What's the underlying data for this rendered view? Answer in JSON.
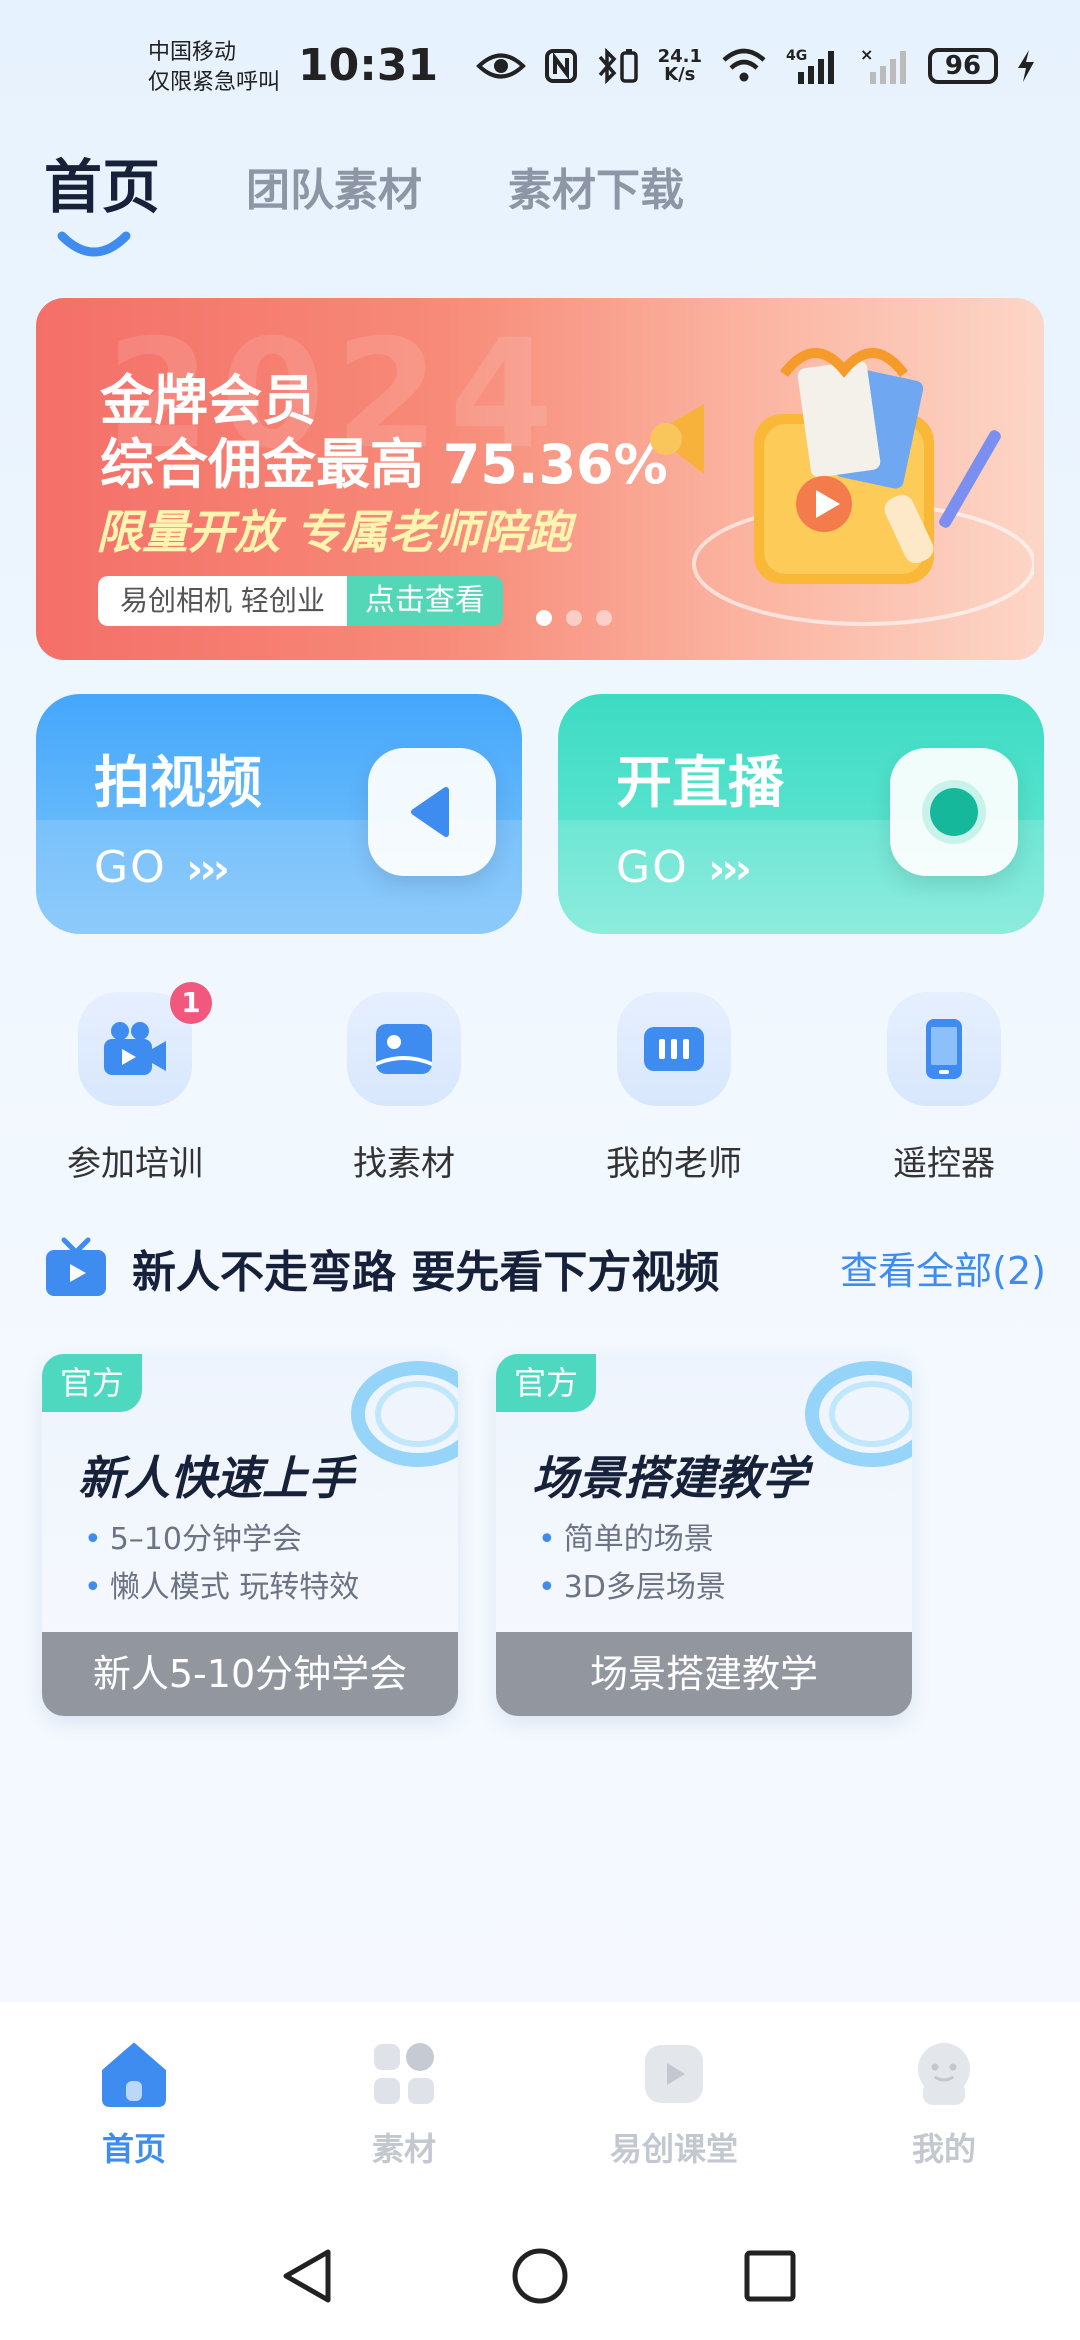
{
  "status_bar": {
    "carrier_line1": "中国移动",
    "carrier_line2": "仅限紧急呼叫",
    "time": "10:31",
    "net_speed_top": "24.1",
    "net_speed_bottom": "K/s",
    "network_type": "4G",
    "battery": "96"
  },
  "top_tabs": [
    {
      "label": "首页",
      "active": true
    },
    {
      "label": "团队素材",
      "active": false
    },
    {
      "label": "素材下载",
      "active": false
    }
  ],
  "banner": {
    "line1": "金牌会员",
    "line2": "综合佣金最高 75.36%",
    "line3": "限量开放 专属老师陪跑",
    "pill_left": "易创相机 轻创业",
    "pill_right": "点击查看",
    "watermark": "2024",
    "dots": 3,
    "active_dot": 0
  },
  "actions": [
    {
      "title": "拍视频",
      "go": "GO",
      "arrows": "›››"
    },
    {
      "title": "开直播",
      "go": "GO",
      "arrows": "›››"
    }
  ],
  "quick_items": [
    {
      "label": "参加培训",
      "icon": "video-camera-icon",
      "badge": "1"
    },
    {
      "label": "找素材",
      "icon": "picture-icon",
      "badge": ""
    },
    {
      "label": "我的老师",
      "icon": "teacher-icon",
      "badge": ""
    },
    {
      "label": "遥控器",
      "icon": "phone-remote-icon",
      "badge": ""
    }
  ],
  "section": {
    "title": "新人不走弯路 要先看下方视频",
    "more": "查看全部(2)"
  },
  "videos": [
    {
      "tag": "官方",
      "headline": "新人快速上手",
      "bullets": [
        "5–10分钟学会",
        "懒人模式 玩转特效"
      ],
      "caption": "新人5-10分钟学会"
    },
    {
      "tag": "官方",
      "headline": "场景搭建教学",
      "bullets": [
        "简单的场景",
        "3D多层场景"
      ],
      "caption": "场景搭建教学"
    }
  ],
  "bottom_nav": [
    {
      "label": "首页",
      "icon": "home-icon",
      "active": true
    },
    {
      "label": "素材",
      "icon": "grid-icon",
      "active": false
    },
    {
      "label": "易创课堂",
      "icon": "play-class-icon",
      "active": false
    },
    {
      "label": "我的",
      "icon": "profile-icon",
      "active": false
    }
  ],
  "colors": {
    "accent": "#3f8cf1",
    "teal": "#4fd8c0",
    "badge": "#f2577e",
    "banner_start": "#f46f68",
    "text_dark": "#17203a",
    "inactive": "#c3c7cf"
  }
}
